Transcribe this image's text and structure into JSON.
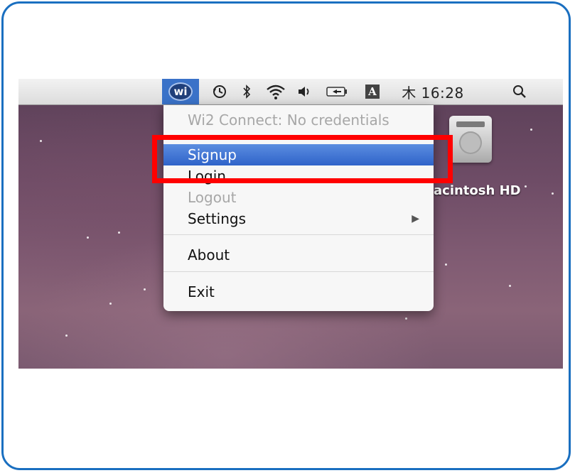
{
  "menubar": {
    "app_icon_label": "wi",
    "clock": "木 16:28",
    "keyboard_input_label": "A",
    "icons": [
      "wi2-icon",
      "time-machine-icon",
      "bluetooth-icon",
      "wifi-icon",
      "volume-icon",
      "battery-icon",
      "input-menu-icon",
      "spotlight-icon"
    ]
  },
  "menu": {
    "header": "Wi2 Connect: No credentials",
    "items": [
      {
        "label": "Signup",
        "selected": true,
        "enabled": true
      },
      {
        "label": "Login",
        "selected": false,
        "enabled": true
      },
      {
        "label": "Logout",
        "selected": false,
        "enabled": false
      },
      {
        "label": "Settings",
        "selected": false,
        "enabled": true,
        "has_submenu": true
      },
      {
        "label": "About",
        "selected": false,
        "enabled": true
      },
      {
        "label": "Exit",
        "selected": false,
        "enabled": true
      }
    ]
  },
  "desktop": {
    "disk_label": "acintosh HD"
  },
  "colors": {
    "frame_border": "#1a6fc0",
    "highlight_box": "#ff0000",
    "menu_selection": "#2f63c9"
  }
}
